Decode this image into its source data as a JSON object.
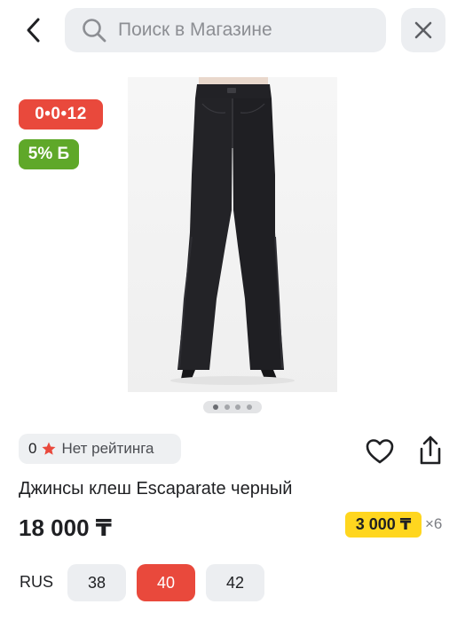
{
  "header": {
    "search_placeholder": "Поиск в Магазине"
  },
  "badges": {
    "installment": "0•0•12",
    "bonus": "5% Б"
  },
  "carousel": {
    "count": 4,
    "active_index": 0
  },
  "rating": {
    "count": "0",
    "label": "Нет рейтинга"
  },
  "product": {
    "title": "Джинсы клеш Escaparate черный",
    "price": "18 000 ₸",
    "installment_price": "3 000 ₸",
    "installment_months": "×6"
  },
  "sizes": {
    "system": "RUS",
    "options": [
      "38",
      "40",
      "42"
    ],
    "selected": "40"
  },
  "colors": {
    "accent_red": "#e9493c",
    "bonus_green": "#5fa829",
    "installment_yellow": "#ffd61f"
  },
  "icons": [
    "back-arrow-icon",
    "search-icon",
    "close-icon",
    "star-icon",
    "heart-icon",
    "share-icon"
  ]
}
